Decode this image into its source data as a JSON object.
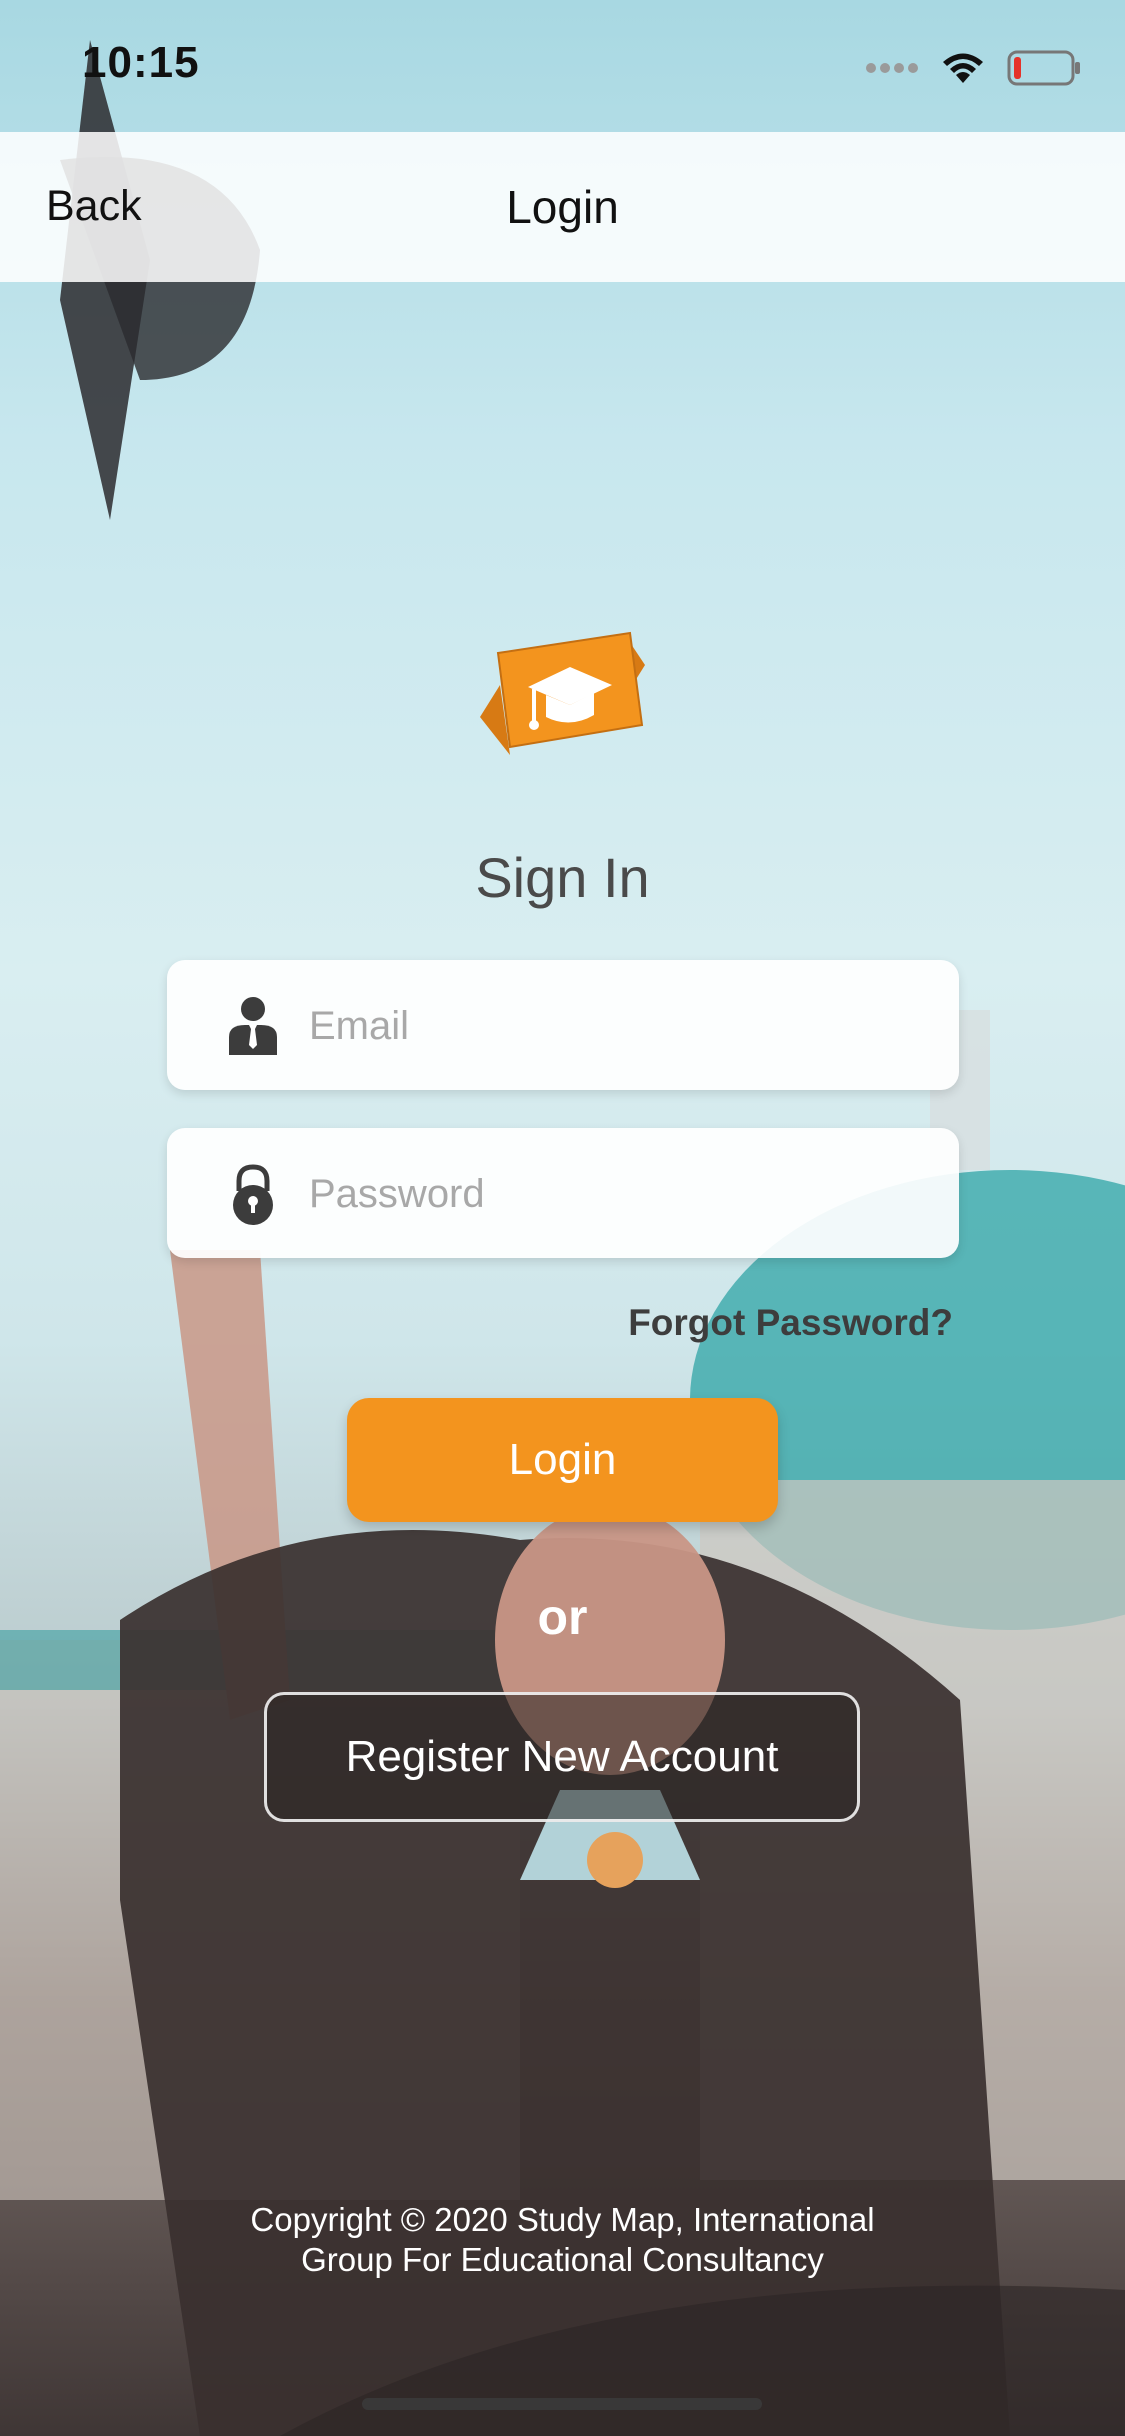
{
  "status_bar": {
    "time": "10:15",
    "signal_icon": "signal-dots-icon",
    "wifi_icon": "wifi-icon",
    "battery_icon": "battery-low-icon"
  },
  "nav": {
    "back_label": "Back",
    "title": "Login"
  },
  "logo": {
    "icon": "graduation-cap-logo"
  },
  "form": {
    "heading": "Sign In",
    "email_placeholder": "Email",
    "email_icon": "user-icon",
    "password_placeholder": "Password",
    "password_icon": "lock-icon",
    "forgot_label": "Forgot Password?",
    "login_label": "Login",
    "or_label": "or",
    "register_label": "Register New Account"
  },
  "footer": {
    "copyright_line1": "Copyright © 2020 Study Map, International",
    "copyright_line2": "Group For Educational Consultancy"
  },
  "colors": {
    "accent": "#f3941e",
    "text_dark": "#4a4a4a"
  }
}
